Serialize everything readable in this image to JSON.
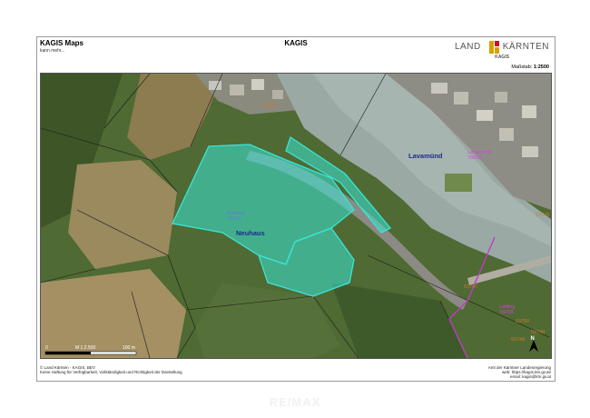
{
  "header": {
    "app_title": "KAGIS Maps",
    "more_link": "kann mehr...",
    "center_title": "KAGIS",
    "logo": {
      "left_text": "LAND",
      "right_text": "KÄRNTEN",
      "sub_text": "KAGIS"
    },
    "scale_label": "Maßstab:",
    "scale_value": "1:2500"
  },
  "map": {
    "place_labels": {
      "lavamuend": "Lavamünd",
      "neuhaus": "Neuhaus"
    },
    "parcels": {
      "p_rothseh": "Rothseh\n76014",
      "p_lavamuend": "Lavamünd\n76014",
      "p_leifling": "Leifling\n76008"
    },
    "road_labels": {
      "r1": "53701",
      "r2": "53746",
      "r3": "53747",
      "r4": "53750",
      "r5": "53748",
      "r6": "53749"
    },
    "scalebar": {
      "start": "0",
      "middle": "M 1:2.500",
      "end": "100 m"
    },
    "north_icon": "north-arrow"
  },
  "footer": {
    "left_line1": "© Land Kärnten - KAGIS, BEV",
    "left_line2": "Keine Haftung für Verfügbarkeit, Vollständigkeit und Richtigkeit der Darstellung",
    "right_line1": "Amt der Kärntner Landesregierung",
    "right_line2": "web: https://kagis.ktn.gv.at/",
    "right_line3": "email: kagis@ktn.gv.at"
  },
  "watermark": "RE/MAX",
  "colors": {
    "highlight": "#39e6d6",
    "river": "#9aa9a4",
    "forest": "#47602e",
    "field": "#a08a5a"
  }
}
